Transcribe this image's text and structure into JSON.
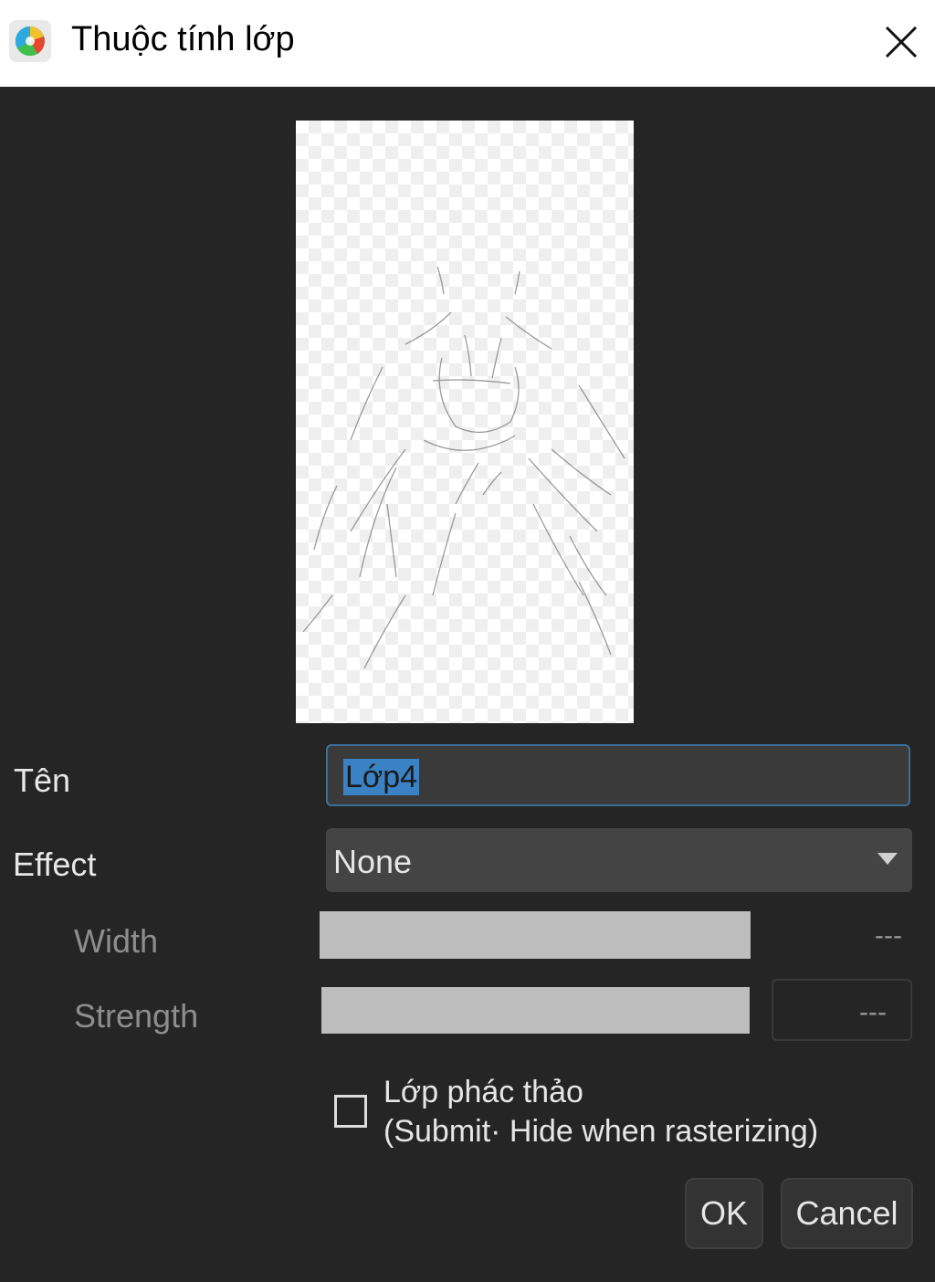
{
  "window": {
    "title": "Thuộc tính lớp",
    "app_icon": "color-wheel-icon",
    "close_icon": "close-icon"
  },
  "form": {
    "name_label": "Tên",
    "name_value": "Lớp4",
    "effect_label": "Effect",
    "effect_value": "None",
    "width_label": "Width",
    "width_value": "---",
    "strength_label": "Strength",
    "strength_value": "---",
    "draft_checked": false,
    "draft_label_line1": "Lớp phác thảo",
    "draft_label_line2": "(Submit· Hide when rasterizing)"
  },
  "buttons": {
    "ok": "OK",
    "cancel": "Cancel"
  },
  "colors": {
    "background": "#252525",
    "selection": "#3b82c4",
    "field_focus_border": "#3d6f99"
  }
}
